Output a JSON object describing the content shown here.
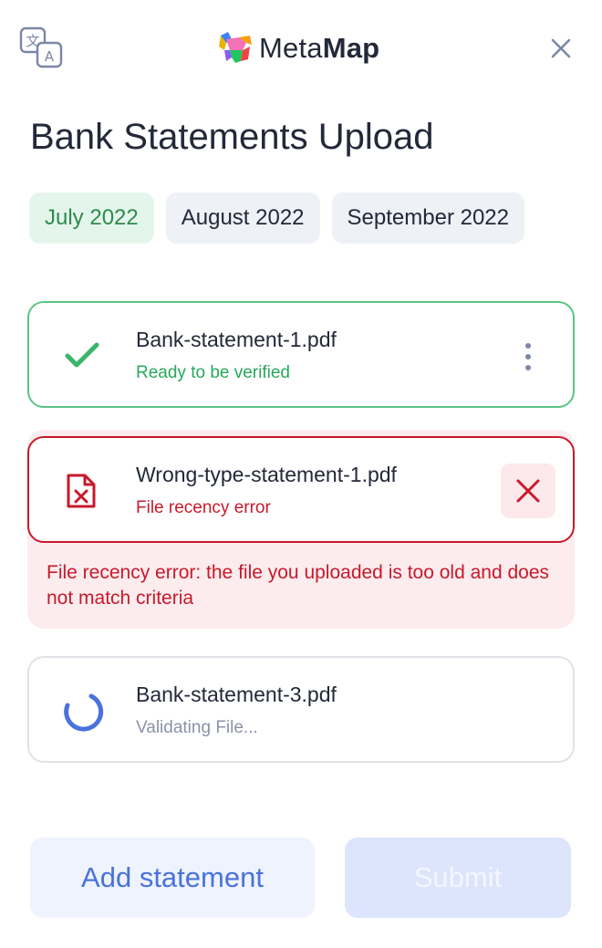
{
  "header": {
    "brand_regular": "Meta",
    "brand_bold": "Map",
    "icons": {
      "language": "translate-icon",
      "close": "close-icon",
      "logo": "metamap-logo"
    }
  },
  "title": "Bank Statements Upload",
  "tabs": [
    {
      "label": "July 2022",
      "active": true
    },
    {
      "label": "August 2022",
      "active": false
    },
    {
      "label": "September 2022",
      "active": false
    }
  ],
  "files": [
    {
      "name": "Bank-statement-1.pdf",
      "status": "Ready to be verified",
      "state": "success",
      "icon": "checkmark-icon",
      "action_icon": "more-vertical-icon"
    },
    {
      "name": "Wrong-type-statement-1.pdf",
      "status": "File recency error",
      "state": "error",
      "icon": "file-error-icon",
      "action_icon": "close-icon",
      "error_message": "File recency error: the file you uploaded is too old and does not match criteria"
    },
    {
      "name": "Bank-statement-3.pdf",
      "status": "Validating File...",
      "state": "loading",
      "icon": "spinner-icon"
    }
  ],
  "actions": {
    "add_label": "Add statement",
    "submit_label": "Submit",
    "submit_disabled": true
  },
  "colors": {
    "success": "#27a85a",
    "error": "#c9192b",
    "accent": "#4a72dc",
    "text": "#232939"
  }
}
